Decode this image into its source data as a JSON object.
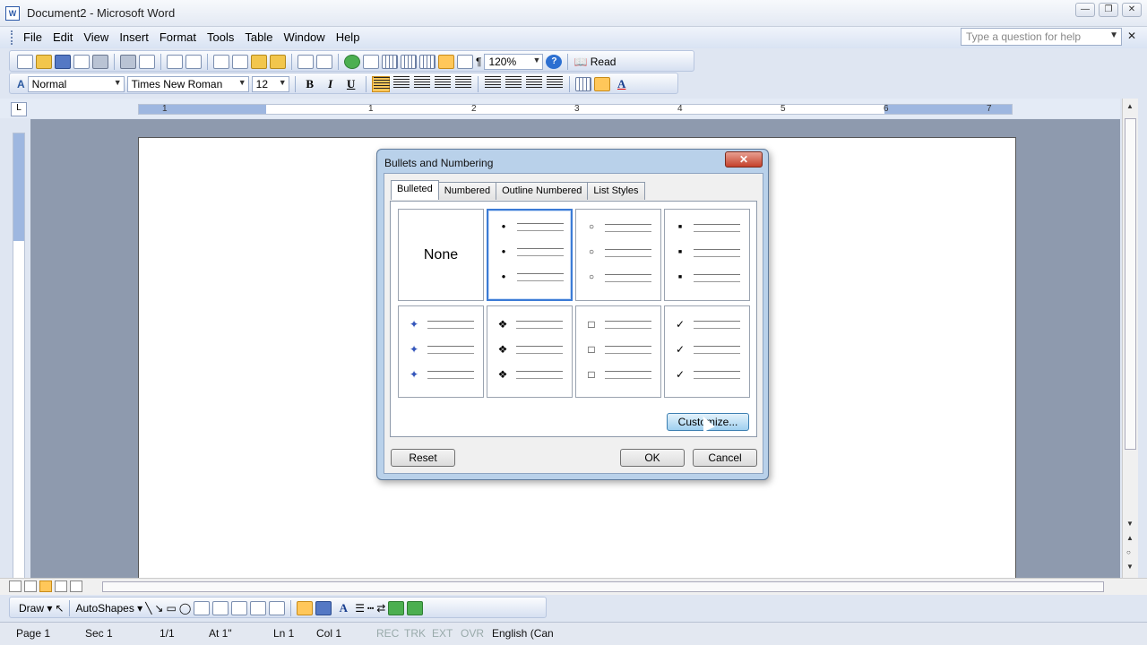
{
  "window": {
    "title": "Document2 - Microsoft Word",
    "min": "—",
    "max": "❐",
    "close": "✕"
  },
  "menu": [
    "File",
    "Edit",
    "View",
    "Insert",
    "Format",
    "Tools",
    "Table",
    "Window",
    "Help"
  ],
  "help_box": {
    "placeholder": "Type a question for help"
  },
  "standard_toolbar": {
    "zoom": "120%",
    "read_label": "Read"
  },
  "formatting_toolbar": {
    "style": "Normal",
    "font": "Times New Roman",
    "size": "12",
    "bold": "B",
    "italic": "I",
    "underline": "U"
  },
  "ruler": {
    "numbers": [
      "1",
      "1",
      "2",
      "3",
      "4",
      "5",
      "6",
      "7"
    ]
  },
  "drawing_toolbar": {
    "draw_label": "Draw",
    "autoshapes_label": "AutoShapes"
  },
  "status_bar": {
    "page": "Page 1",
    "sec": "Sec 1",
    "pages": "1/1",
    "at": "At 1\"",
    "ln": "Ln 1",
    "col": "Col 1",
    "rec": "REC",
    "trk": "TRK",
    "ext": "EXT",
    "ovr": "OVR",
    "lang": "English (Can"
  },
  "dialog": {
    "title": "Bullets and Numbering",
    "close_label": "✕",
    "tabs": [
      "Bulleted",
      "Numbered",
      "Outline Numbered",
      "List Styles"
    ],
    "none_label": "None",
    "bullet_styles": [
      "●",
      "○",
      "■",
      "✦",
      "❖",
      "□",
      "✓"
    ],
    "customize_label": "Customize...",
    "reset_label": "Reset",
    "ok_label": "OK",
    "cancel_label": "Cancel"
  }
}
